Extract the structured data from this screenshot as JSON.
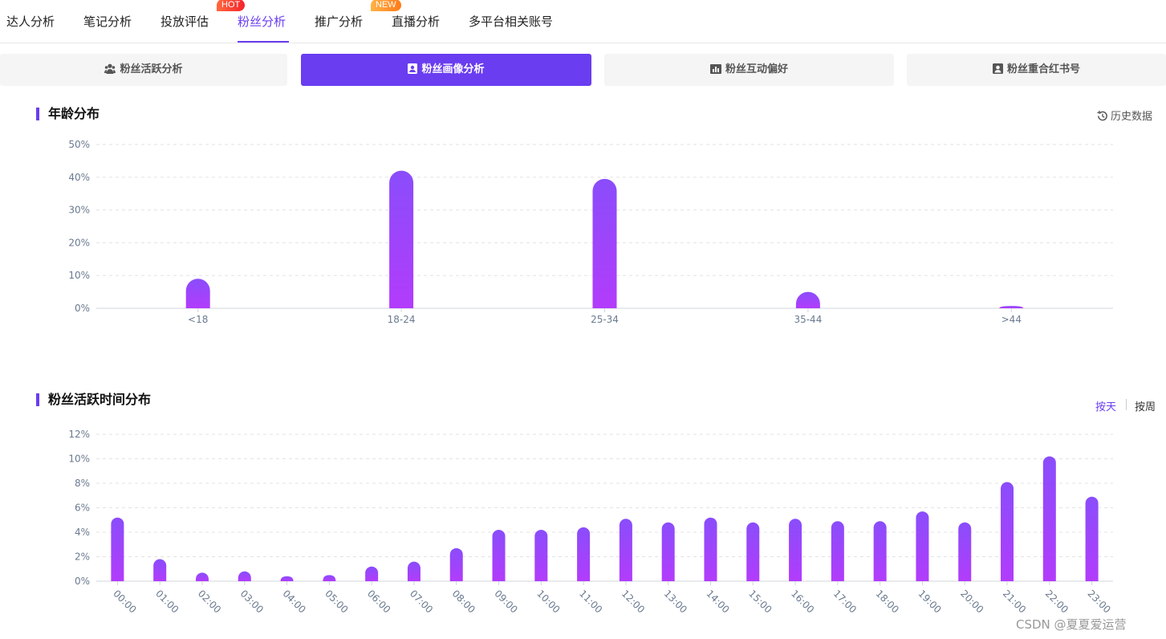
{
  "topnav": {
    "tabs": [
      {
        "label": "达人分析"
      },
      {
        "label": "笔记分析"
      },
      {
        "label": "投放评估",
        "badge": "HOT"
      },
      {
        "label": "粉丝分析",
        "active": true
      },
      {
        "label": "推广分析",
        "badge": "NEW"
      },
      {
        "label": "直播分析"
      },
      {
        "label": "多平台相关账号"
      }
    ]
  },
  "subtabs": [
    {
      "label": "粉丝活跃分析",
      "icon": "users-icon"
    },
    {
      "label": "粉丝画像分析",
      "icon": "profile-icon",
      "active": true
    },
    {
      "label": "粉丝互动偏好",
      "icon": "chart-icon"
    },
    {
      "label": "粉丝重合红书号",
      "icon": "account-icon"
    }
  ],
  "sections": {
    "age": {
      "title": "年龄分布",
      "history_label": "历史数据"
    },
    "active_time": {
      "title": "粉丝活跃时间分布",
      "toggle_day": "按天",
      "toggle_week": "按周"
    }
  },
  "colors": {
    "accent": "#6a3df0",
    "bar_top": "#8a4dfb",
    "bar_bottom": "#b23cfb"
  },
  "chart_data": [
    {
      "type": "bar",
      "categories": [
        "<18",
        "18-24",
        "25-34",
        "35-44",
        ">44"
      ],
      "values": [
        9,
        42,
        39.5,
        5,
        0.7
      ],
      "y_ticks": [
        "0%",
        "10%",
        "20%",
        "30%",
        "40%",
        "50%"
      ],
      "ylim": [
        0,
        50
      ],
      "grid": true
    },
    {
      "type": "bar",
      "categories": [
        "00:00",
        "01:00",
        "02:00",
        "03:00",
        "04:00",
        "05:00",
        "06:00",
        "07:00",
        "08:00",
        "09:00",
        "10:00",
        "11:00",
        "12:00",
        "13:00",
        "14:00",
        "15:00",
        "16:00",
        "17:00",
        "18:00",
        "19:00",
        "20:00",
        "21:00",
        "22:00",
        "23:00"
      ],
      "values": [
        5.2,
        1.8,
        0.7,
        0.8,
        0.4,
        0.5,
        1.2,
        1.6,
        2.7,
        4.2,
        4.2,
        4.4,
        5.1,
        4.8,
        5.2,
        4.8,
        5.1,
        4.9,
        4.9,
        5.7,
        4.8,
        8.1,
        10.2,
        6.9
      ],
      "y_ticks": [
        "0%",
        "2%",
        "4%",
        "6%",
        "8%",
        "10%",
        "12%"
      ],
      "ylim": [
        0,
        12
      ],
      "grid": true
    }
  ],
  "watermark": "CSDN @夏夏爱运营"
}
